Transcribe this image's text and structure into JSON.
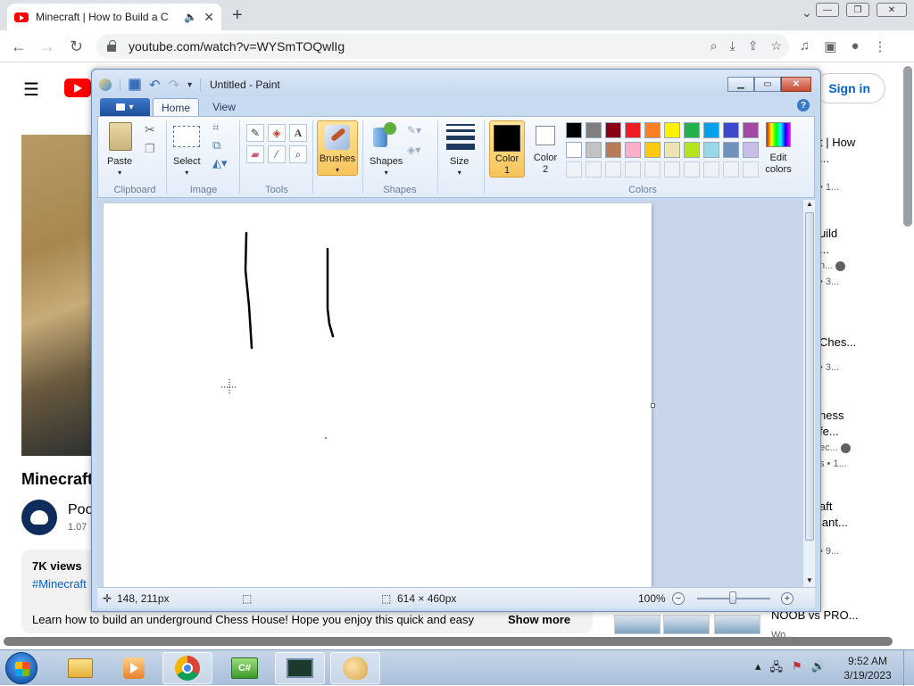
{
  "browser": {
    "tab_title": "Minecraft | How to Build a C",
    "tab_audio": "🔈",
    "tab_close": "✕",
    "new_tab": "+",
    "url": "youtube.com/watch?v=WYSmTOQwlIg"
  },
  "youtube": {
    "signin": "Sign in",
    "video_title": "Minecraft",
    "channel_name": "Poo",
    "channel_subs": "1.07",
    "views": "7K views",
    "hashtag": "#Minecraft",
    "description": "Learn how to build an underground Chess House! Hope you enjoy this quick and easy",
    "show_more": "Show more",
    "recommendations": [
      {
        "line1": "t | How",
        "line2": "...",
        "meta": "• 1..."
      },
      {
        "line1": "uild",
        "line2": "...",
        "meta": "n...",
        "meta2": "• 3..."
      },
      {
        "line1": "Ches...",
        "line2": "",
        "meta": "• 3..."
      },
      {
        "line1": "hess",
        "line2": "fe...",
        "meta": "ec...",
        "meta2": "s • 1..."
      },
      {
        "line1": "aft",
        "line2": "iant...",
        "meta": "• 9..."
      }
    ],
    "rec_bottom_title": "NOOB vs PRO...",
    "rec_bottom_meta": "Wo..."
  },
  "paint": {
    "window_title": "Untitled - Paint",
    "tabs": {
      "home": "Home",
      "view": "View"
    },
    "help": "?",
    "ribbon": {
      "paste": "Paste",
      "select": "Select",
      "brushes": "Brushes",
      "shapes": "Shapes",
      "size": "Size",
      "color1": "Color\n1",
      "color1_a": "Color",
      "color1_b": "1",
      "color2_a": "Color",
      "color2_b": "2",
      "edit_colors_a": "Edit",
      "edit_colors_b": "colors",
      "groups": {
        "clipboard": "Clipboard",
        "image": "Image",
        "tools": "Tools",
        "brushes": "",
        "shapes": "Shapes",
        "colors": "Colors"
      }
    },
    "palette_row1": [
      "#000000",
      "#7f7f7f",
      "#880015",
      "#ed1c24",
      "#ff7f27",
      "#fff200",
      "#22b14c",
      "#00a2e8",
      "#3f48cc",
      "#a349a4"
    ],
    "palette_row2": [
      "#ffffff",
      "#c3c3c3",
      "#b97a57",
      "#ffaec9",
      "#ffc90e",
      "#efe4b0",
      "#b5e61d",
      "#99d9ea",
      "#7092be",
      "#c8bfe7"
    ],
    "color1_value": "#000000",
    "color2_value": "#ffffff",
    "status": {
      "cursor_pos": "148, 211px",
      "canvas_size": "614 × 460px",
      "zoom": "100%"
    }
  },
  "taskbar": {
    "time": "9:52 AM",
    "date": "3/19/2023"
  }
}
